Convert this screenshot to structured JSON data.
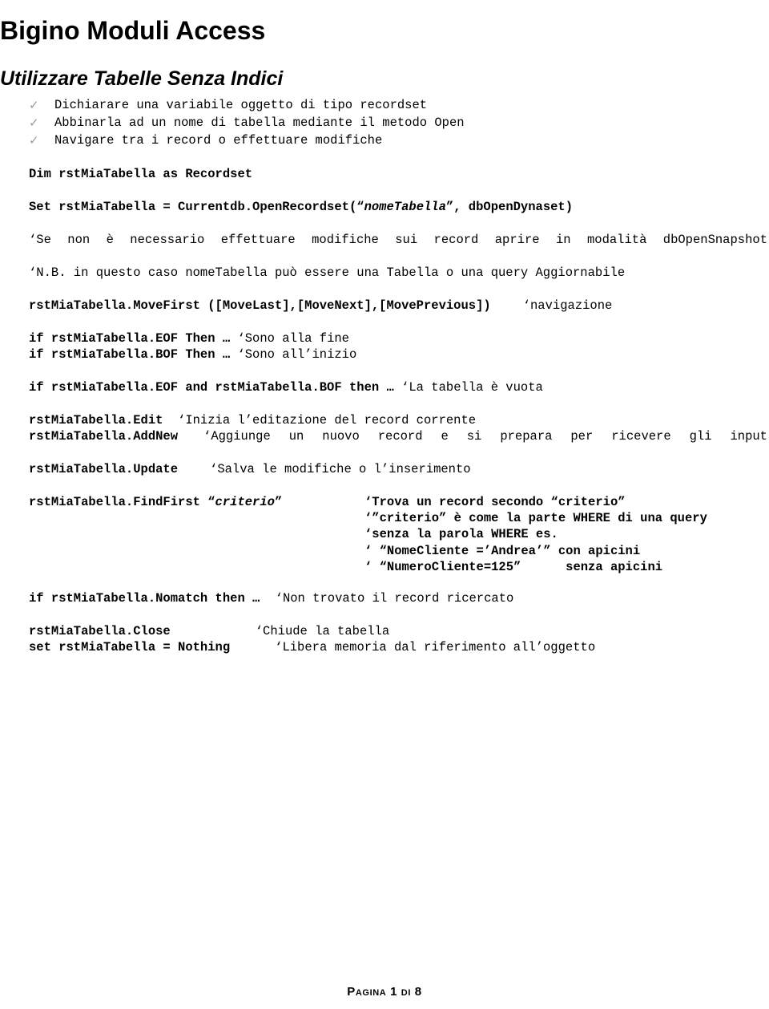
{
  "document": {
    "title": "Bigino Moduli Access",
    "subtitle": "Utilizzare Tabelle Senza Indici"
  },
  "bullets": {
    "marker_glyph": "✓",
    "marker_color": "#9a9a9a",
    "items": [
      "Dichiarare una variabile oggetto di tipo recordset",
      "Abbinarla ad un nome di tabella mediante il metodo Open",
      "Navigare tra i record o effettuare modifiche"
    ]
  },
  "code": {
    "dim_line": "Dim rstMiaTabella as Recordset",
    "set_line_prefix": "Set rstMiaTabella = Currentdb.OpenRecordset(“",
    "set_line_italic": "nomeTabella",
    "set_line_suffix": "”, dbOpenDynaset)",
    "note_snapshot": "‘Se non è necessario effettuare modifiche sui record aprire in modalità dbOpenSnapshot",
    "note_nb": "‘N.B. in questo caso nomeTabella può essere una Tabella o una query Aggiornabile",
    "movefirst_code": "rstMiaTabella.MoveFirst ([MoveLast],[MoveNext],[MovePrevious])",
    "movefirst_comment": "‘navigazione",
    "eof_code": "if rstMiaTabella.EOF Then … ",
    "eof_comment": "‘Sono alla fine",
    "bof_code": "if rstMiaTabella.BOF Then … ",
    "bof_comment": "‘Sono all’inizio",
    "empty_code": "if rstMiaTabella.EOF and rstMiaTabella.BOF then … ",
    "empty_comment": "‘La tabella è vuota",
    "edit_code": "rstMiaTabella.Edit  ",
    "edit_comment": "‘Inizia l’editazione del record corrente",
    "addnew_code": "rstMiaTabella.AddNew",
    "addnew_comment": "‘Aggiunge un nuovo record e si prepara per ricevere gli input",
    "update_code": "rstMiaTabella.Update",
    "update_comment": "‘Salva le modifiche o l’inserimento",
    "findfirst_code_prefix": "rstMiaTabella.FindFirst “",
    "findfirst_code_italic": "criterio",
    "findfirst_code_suffix": "”",
    "findfirst_comments": [
      "‘Trova un record secondo “criterio”",
      "‘”criterio” è come la parte WHERE di una query",
      "‘senza la parola WHERE es.",
      "‘ “NomeCliente =’Andrea’” con apicini",
      "‘ “NumeroCliente=125”      senza apicini"
    ],
    "nomatch_code": "if rstMiaTabella.Nomatch then … ",
    "nomatch_comment": "‘Non trovato il record ricercato",
    "close_code": "rstMiaTabella.Close",
    "close_comment": "‘Chiude la tabella",
    "nothing_code": "set rstMiaTabella = Nothing",
    "nothing_comment": "‘Libera memoria dal riferimento all’oggetto"
  },
  "footer": {
    "page_label": "Pagina 1 di 8"
  }
}
